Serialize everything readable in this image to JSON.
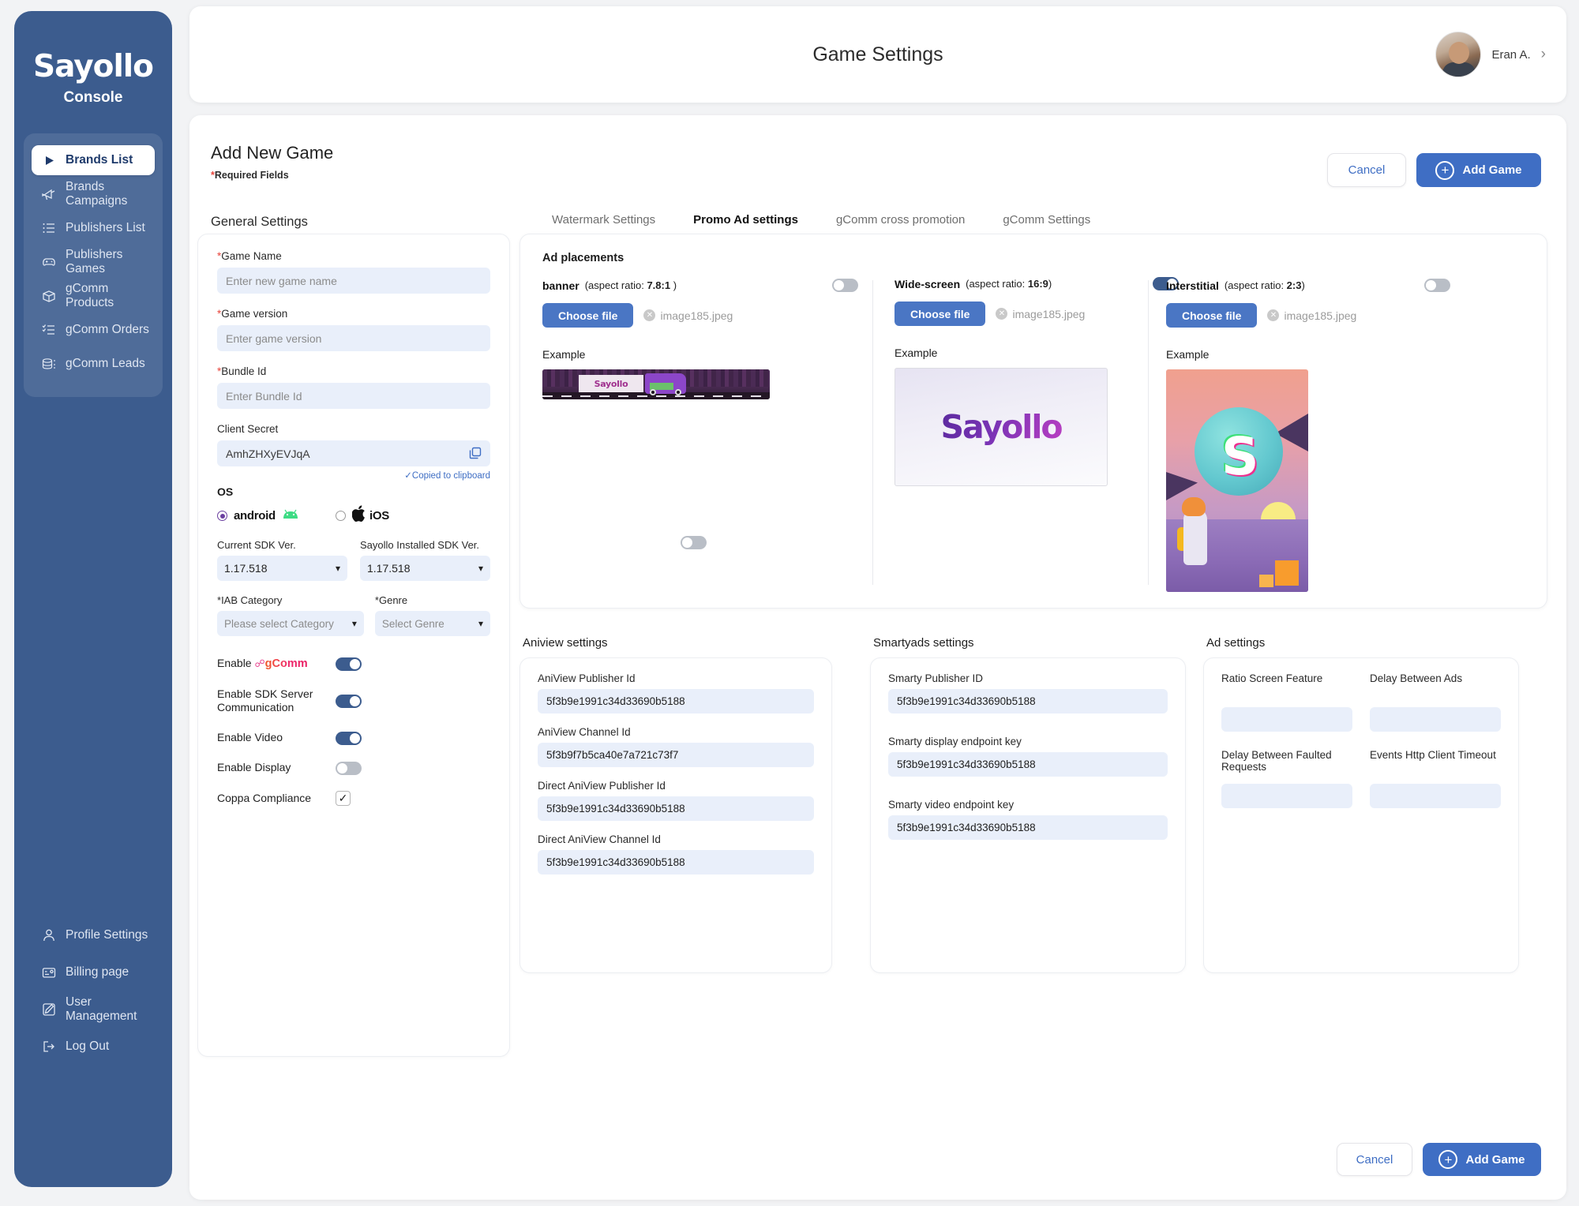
{
  "sidebar": {
    "logo": "Sayollo",
    "logo_sub": "Console",
    "items": [
      {
        "label": "Brands List",
        "icon": "play-triangle-icon",
        "active": true
      },
      {
        "label": "Brands Campaigns",
        "icon": "megaphone-icon",
        "active": false
      },
      {
        "label": "Publishers List",
        "icon": "list-icon",
        "active": false
      },
      {
        "label": "Publishers Games",
        "icon": "gamepad-icon",
        "active": false
      },
      {
        "label": "gComm Products",
        "icon": "box-icon",
        "active": false
      },
      {
        "label": "gComm Orders",
        "icon": "checklist-icon",
        "active": false
      },
      {
        "label": "gComm Leads",
        "icon": "stack-icon",
        "active": false
      }
    ],
    "bottom_items": [
      {
        "label": "Profile Settings",
        "icon": "user-icon"
      },
      {
        "label": "Billing page",
        "icon": "credit-card-icon"
      },
      {
        "label": "User Management",
        "icon": "edit-square-icon"
      },
      {
        "label": "Log Out",
        "icon": "logout-icon"
      }
    ]
  },
  "header": {
    "title": "Game Settings",
    "user_name": "Eran A.",
    "chevron": "›"
  },
  "main": {
    "title": "Add New Game",
    "required_note": "Required Fields",
    "required_star": "*",
    "general_settings_label": "General Settings",
    "cancel_label": "Cancel",
    "add_game_label": "Add Game",
    "plus_glyph": "+"
  },
  "tabs": [
    {
      "label": "Watermark Settings",
      "active": false
    },
    {
      "label": "Promo Ad settings",
      "active": true
    },
    {
      "label": "gComm cross promotion",
      "active": false
    },
    {
      "label": "gComm Settings",
      "active": false
    }
  ],
  "general_form": {
    "fields": [
      {
        "label": "Game Name",
        "required": true,
        "placeholder": "Enter new game name",
        "value": ""
      },
      {
        "label": "Game version",
        "required": true,
        "placeholder": "Enter game version",
        "value": ""
      },
      {
        "label": "Bundle Id",
        "required": true,
        "placeholder": "Enter Bundle Id",
        "value": ""
      }
    ],
    "client_secret": {
      "label": "Client Secret",
      "value": "AmhZHXyEVJqA",
      "copied_message": "✓Copied to clipboard",
      "copy_icon": "copy-icon"
    },
    "os": {
      "label": "OS",
      "options": [
        {
          "label": "android",
          "selected": true,
          "icon": "android-icon"
        },
        {
          "label": "iOS",
          "selected": false,
          "icon": "apple-icon"
        }
      ]
    },
    "sdk": [
      {
        "label": "Current SDK Ver.",
        "value": "1.17.518"
      },
      {
        "label": "Sayollo Installed SDK Ver.",
        "value": "1.17.518"
      }
    ],
    "category": [
      {
        "label": "IAB Category",
        "required": true,
        "value": "Please select Category",
        "is_placeholder": true
      },
      {
        "label": "Genre",
        "required": true,
        "value": "Select Genre",
        "is_placeholder": true
      }
    ],
    "toggles": [
      {
        "label": "Enable ",
        "brand": "gComm",
        "on": true,
        "type": "switch"
      },
      {
        "label": "Enable SDK Server Communication",
        "on": true,
        "type": "switch"
      },
      {
        "label": "Enable Video",
        "on": true,
        "type": "switch"
      },
      {
        "label": "Enable Display",
        "on": false,
        "type": "switch"
      },
      {
        "label": "Coppa Compliance",
        "on": true,
        "type": "checkbox",
        "check_glyph": "✓"
      }
    ]
  },
  "promo": {
    "section_label": "Ad placements",
    "example_label": "Example",
    "choose_file_label": "Choose file",
    "x_glyph": "✕",
    "placements": [
      {
        "name": "banner",
        "ratio_prefix": "(aspect ratio: ",
        "ratio": "7.8:1",
        "ratio_suffix": " )",
        "enabled": false,
        "file": "image185.jpeg"
      },
      {
        "name": "Wide-screen",
        "ratio_prefix": "(aspect ratio: ",
        "ratio": "16:9",
        "ratio_suffix": ")",
        "enabled": true,
        "file": "image185.jpeg"
      },
      {
        "name": "Interstitial",
        "ratio_prefix": "(aspect ratio: ",
        "ratio": "2:3",
        "ratio_suffix": ")",
        "enabled": false,
        "file": "image185.jpeg"
      }
    ],
    "wide_example_brand": "Sayollo",
    "banner_example_brand": "Sayollo",
    "interstitial_letter": "S",
    "extra_toggle_on": false
  },
  "aniview": {
    "section_label": "Aniview settings",
    "fields": [
      {
        "label": "AniView Publisher Id",
        "value": "5f3b9e1991c34d33690b5188"
      },
      {
        "label": "AniView Channel Id",
        "value": "5f3b9f7b5ca40e7a721c73f7"
      },
      {
        "label": "Direct AniView Publisher Id",
        "value": "5f3b9e1991c34d33690b5188"
      },
      {
        "label": "Direct AniView Channel Id",
        "value": "5f3b9e1991c34d33690b5188"
      }
    ]
  },
  "smartyads": {
    "section_label": "Smartyads settings",
    "fields": [
      {
        "label": "Smarty Publisher ID",
        "value": "5f3b9e1991c34d33690b5188"
      },
      {
        "label": "Smarty display endpoint key",
        "value": "5f3b9e1991c34d33690b5188"
      },
      {
        "label": "Smarty video endpoint key",
        "value": "5f3b9e1991c34d33690b5188"
      }
    ]
  },
  "ad_settings": {
    "section_label": "Ad settings",
    "fields": [
      {
        "label": "Ratio Screen Feature",
        "value": ""
      },
      {
        "label": "Delay Between Ads",
        "value": ""
      },
      {
        "label": "Delay Between Faulted Requests",
        "value": ""
      },
      {
        "label": "Events Http Client Timeout",
        "value": ""
      }
    ]
  },
  "footer": {
    "cancel_label": "Cancel",
    "add_game_label": "Add Game",
    "plus_glyph": "+"
  },
  "colors": {
    "sidebar": "#3c5c8e",
    "accent": "#3f6ec4",
    "button_blue": "#4a76c4",
    "input_bg": "#e9effa",
    "required_red": "#e8453c",
    "page_bg": "#f2f3f5"
  }
}
